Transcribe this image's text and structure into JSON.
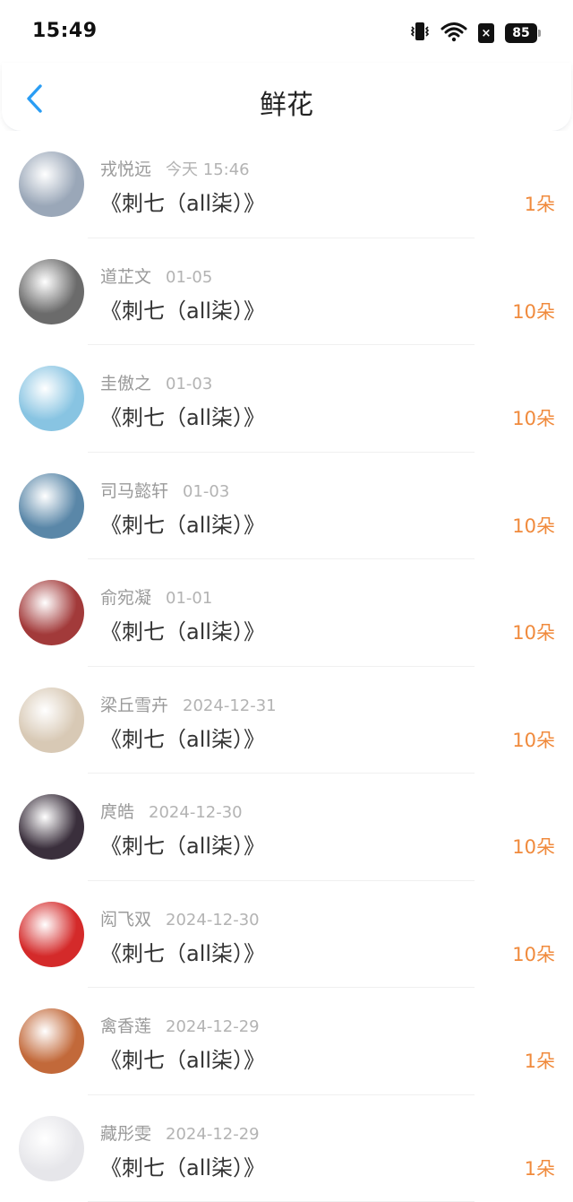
{
  "status": {
    "time": "15:49",
    "battery": "85",
    "sim": "×"
  },
  "header": {
    "title": "鲜花"
  },
  "items": [
    {
      "name": "戎悦远",
      "date": "今天 15:46",
      "book": "《刺七（all柒）》",
      "count": "1朵",
      "avatar_color": "#9aa7b8"
    },
    {
      "name": "道芷文",
      "date": "01-05",
      "book": "《刺七（all柒）》",
      "count": "10朵",
      "avatar_color": "#6b6b6b"
    },
    {
      "name": "圭傲之",
      "date": "01-03",
      "book": "《刺七（all柒）》",
      "count": "10朵",
      "avatar_color": "#88c4e2"
    },
    {
      "name": "司马懿轩",
      "date": "01-03",
      "book": "《刺七（all柒）》",
      "count": "10朵",
      "avatar_color": "#5a87a8"
    },
    {
      "name": "俞宛凝",
      "date": "01-01",
      "book": "《刺七（all柒）》",
      "count": "10朵",
      "avatar_color": "#a23a3a"
    },
    {
      "name": "梁丘雪卉",
      "date": "2024-12-31",
      "book": "《刺七（all柒）》",
      "count": "10朵",
      "avatar_color": "#d8c9b5"
    },
    {
      "name": "庹皓",
      "date": "2024-12-30",
      "book": "《刺七（all柒）》",
      "count": "10朵",
      "avatar_color": "#3a2f3c"
    },
    {
      "name": "闳飞双",
      "date": "2024-12-30",
      "book": "《刺七（all柒）》",
      "count": "10朵",
      "avatar_color": "#d42a2a"
    },
    {
      "name": "禽香莲",
      "date": "2024-12-29",
      "book": "《刺七（all柒）》",
      "count": "1朵",
      "avatar_color": "#c2693a"
    },
    {
      "name": "藏彤雯",
      "date": "2024-12-29",
      "book": "《刺七（all柒）》",
      "count": "1朵",
      "avatar_color": "#e6e6ea"
    }
  ],
  "colors": {
    "accent": "#2a9df4",
    "count": "#f08a3c"
  }
}
